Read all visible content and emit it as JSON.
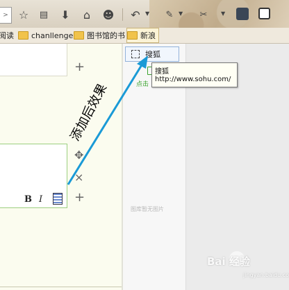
{
  "toolbar": {
    "url_fragment": ">",
    "icons": [
      "star-icon",
      "reader-icon",
      "download-icon",
      "home-icon",
      "emoji-icon",
      "undo-icon",
      "plugin-icon",
      "screenshot-icon",
      "folder-icon",
      "window-icon"
    ]
  },
  "bookmarks": {
    "items": [
      {
        "label": "阅读"
      },
      {
        "label": "chanllenge"
      },
      {
        "label": "图书馆的书"
      },
      {
        "label": "新浪"
      }
    ]
  },
  "dropdown": {
    "item_label": "搜狐"
  },
  "tooltip": {
    "title": "搜狐",
    "url": "http://www.sohu.com/"
  },
  "editor": {
    "bold_label": "B",
    "italic_label": "I",
    "plus_label": "+",
    "close_label": "×",
    "move_label": "✥"
  },
  "middle": {
    "green_text": "点击",
    "empty_text": "图库暂无图片"
  },
  "annotation": {
    "text": "添加后效果",
    "color": "#1a9ad6"
  },
  "watermark": {
    "text": "Bai 经验",
    "sub": "jingyan.baidu.com"
  }
}
